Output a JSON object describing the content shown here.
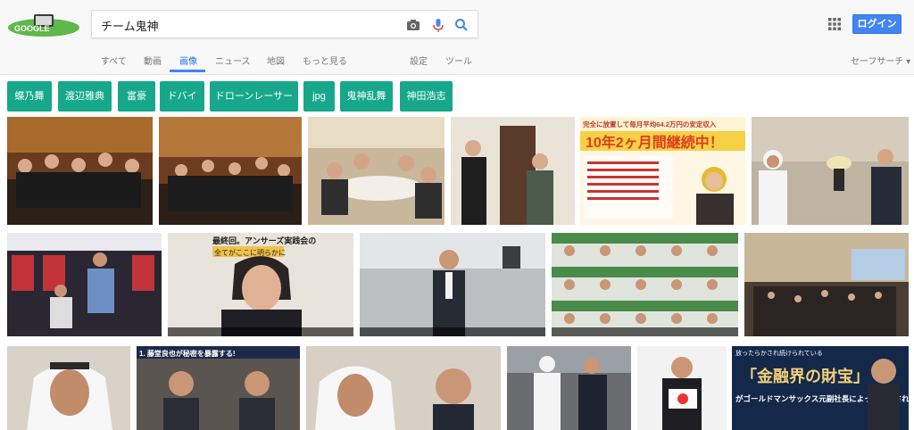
{
  "search": {
    "query": "チーム鬼神"
  },
  "header": {
    "login_label": "ログイン",
    "safesearch_label": "セーフサーチ ▾"
  },
  "tabs": [
    "すべて",
    "動画",
    "画像",
    "ニュース",
    "地図",
    "もっと見る",
    "設定",
    "ツール"
  ],
  "active_tab": "画像",
  "chips": [
    "蝶乃舞",
    "渡辺雅典",
    "富豪",
    "ドバイ",
    "ドローンレーサー",
    "jpg",
    "鬼神乱舞",
    "神田浩志"
  ],
  "colors": {
    "accent": "#4285f4",
    "chip": "#17a88b"
  },
  "thumbnails": [
    {
      "alt": "group-photo-party"
    },
    {
      "alt": "group-photo-party-2"
    },
    {
      "alt": "restaurant-group"
    },
    {
      "alt": "speaker-microphone"
    },
    {
      "alt": "ad-banner-income",
      "banner_line1": "完全に放置して毎月平均64.2万円の安定収入",
      "banner_line2": "10年2ヶ月間継続中！"
    },
    {
      "alt": "arab-man-meeting"
    },
    {
      "alt": "arcade-scene"
    },
    {
      "alt": "video-presenter",
      "banner_line1": "最終回。アンサーズ実践会の",
      "banner_line2": "全てがここに明らかに"
    },
    {
      "alt": "video-station-man"
    },
    {
      "alt": "video-grid-people"
    },
    {
      "alt": "banquet-hall"
    },
    {
      "alt": "arab-man-closeup"
    },
    {
      "alt": "two-men-secret",
      "banner_line1": "1. 藤堂良也が秘密を暴露する!"
    },
    {
      "alt": "arab-man-and-man"
    },
    {
      "alt": "handshake-arab"
    },
    {
      "alt": "man-with-sign"
    },
    {
      "alt": "goldman-banner",
      "banner_line1": "放ったらかされ続けられている",
      "banner_line2": "「金融界の財宝」",
      "banner_line3": "がゴールドマンサックス元副社長によって分配される!!"
    }
  ]
}
